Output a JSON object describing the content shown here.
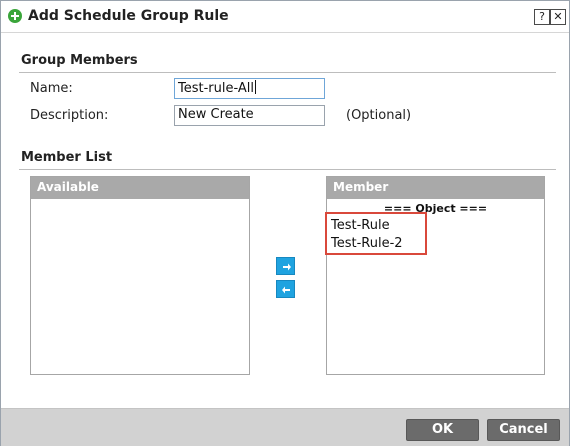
{
  "dialog": {
    "title": "Add Schedule Group Rule",
    "help_label": "?",
    "close_label": "✕"
  },
  "group_members": {
    "section_title": "Group Members",
    "name_label": "Name:",
    "name_value": "Test-rule-All",
    "description_label": "Description:",
    "description_value": "New Create",
    "optional_note": "(Optional)"
  },
  "member_list": {
    "section_title": "Member List",
    "available_header": "Available",
    "available_items": [],
    "member_header": "Member",
    "member_group_header": "=== Object ===",
    "member_items": [
      "Test-Rule",
      "Test-Rule-2"
    ],
    "add_icon": "arrow-right-icon",
    "remove_icon": "arrow-left-icon"
  },
  "footer": {
    "ok_label": "OK",
    "cancel_label": "Cancel"
  },
  "colors": {
    "accent_button": "#1fa3e0",
    "header_gray": "#a9a9a9",
    "highlight": "#d9483b",
    "title_icon": "#3aa53a"
  }
}
